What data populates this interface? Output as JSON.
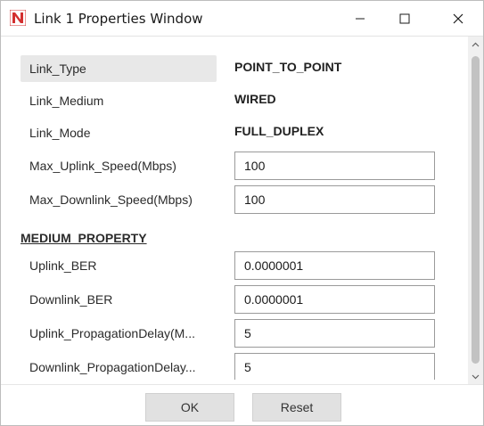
{
  "window": {
    "title": "Link 1 Properties Window",
    "app_icon": "netsim-n-logo-icon"
  },
  "controls": {
    "minimize_icon": "minimize-icon",
    "maximize_icon": "maximize-icon",
    "close_icon": "close-icon"
  },
  "properties": [
    {
      "label": "Link_Type",
      "value": "POINT_TO_POINT",
      "kind": "text",
      "selected": true
    },
    {
      "label": "Link_Medium",
      "value": "WIRED",
      "kind": "text"
    },
    {
      "label": "Link_Mode",
      "value": "FULL_DUPLEX",
      "kind": "text"
    },
    {
      "label": "Max_Uplink_Speed(Mbps)",
      "value": "100",
      "kind": "input"
    },
    {
      "label": "Max_Downlink_Speed(Mbps)",
      "value": "100",
      "kind": "input"
    }
  ],
  "medium_section": {
    "heading": "MEDIUM_PROPERTY",
    "properties": [
      {
        "label": "Uplink_BER",
        "value": "0.0000001",
        "kind": "input"
      },
      {
        "label": "Downlink_BER",
        "value": "0.0000001",
        "kind": "input"
      },
      {
        "label": "Uplink_PropagationDelay(M...",
        "value": "5",
        "kind": "input"
      },
      {
        "label": "Downlink_PropagationDelay...",
        "value": "5",
        "kind": "input"
      }
    ]
  },
  "footer": {
    "ok_label": "OK",
    "reset_label": "Reset"
  },
  "colors": {
    "accent_red": "#d32f2f",
    "selected_row": "#e8e8e8",
    "button_bg": "#e1e1e1"
  }
}
